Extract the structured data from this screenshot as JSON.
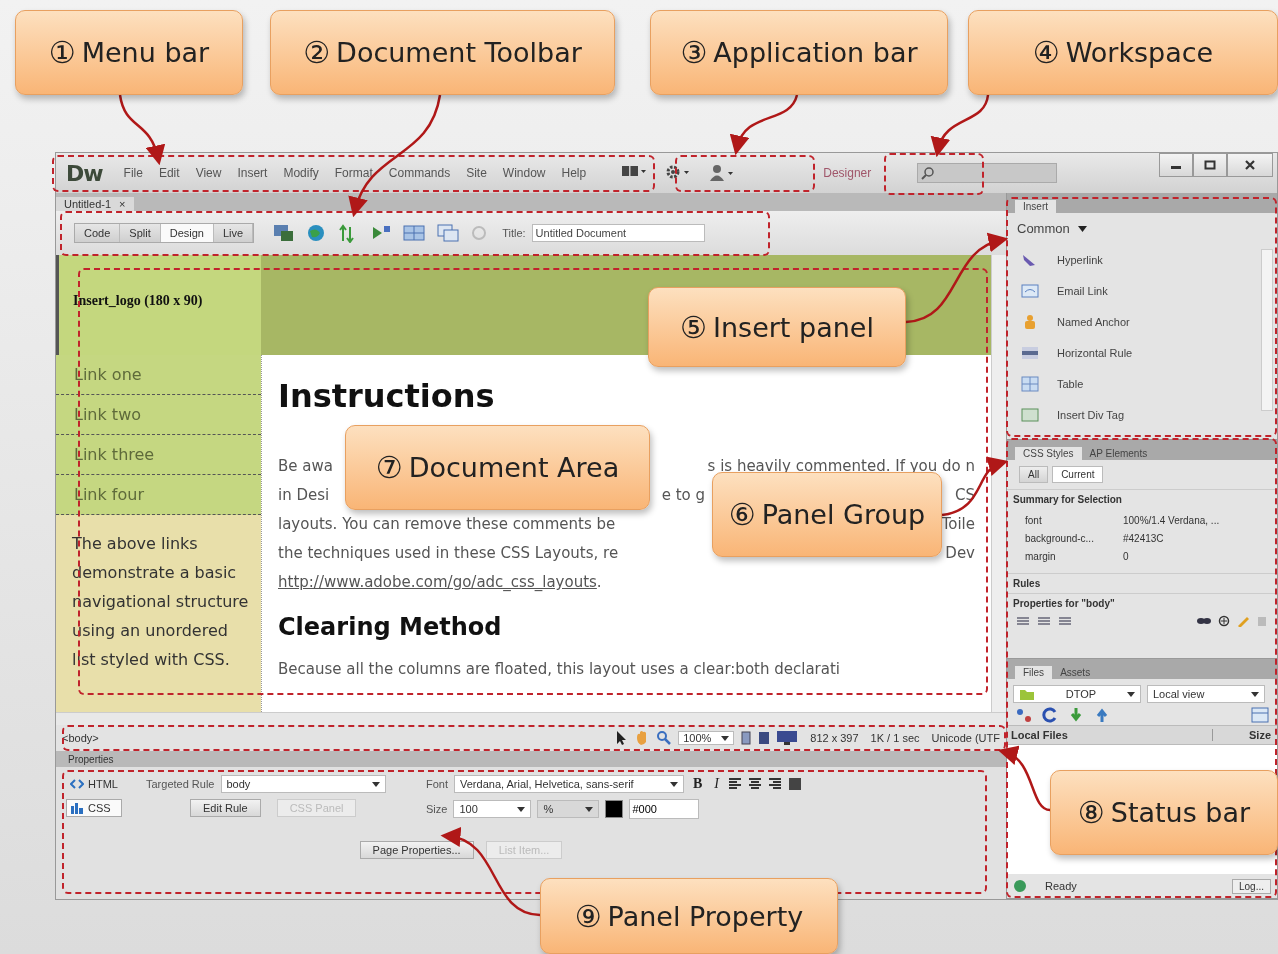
{
  "callouts": [
    {
      "number": "①",
      "label": "Menu bar"
    },
    {
      "number": "②",
      "label": "Document Toolbar"
    },
    {
      "number": "③",
      "label": "Application bar"
    },
    {
      "number": "④",
      "label": "Workspace"
    },
    {
      "number": "⑤",
      "label": "Insert panel"
    },
    {
      "number": "⑦",
      "label": "Document Area"
    },
    {
      "number": "⑥",
      "label": "Panel Group"
    },
    {
      "number": "⑧",
      "label": "Status bar"
    },
    {
      "number": "⑨",
      "label": "Panel Property"
    }
  ],
  "menu_bar": {
    "logo": "Dw",
    "items": [
      "File",
      "Edit",
      "View",
      "Insert",
      "Modify",
      "Format",
      "Commands",
      "Site",
      "Window",
      "Help"
    ]
  },
  "application_bar": {
    "workspace": "Designer"
  },
  "document_tab": {
    "title": "Untitled-1",
    "close": "×"
  },
  "document_toolbar": {
    "views": [
      {
        "label": "Code",
        "selected": false
      },
      {
        "label": "Split",
        "selected": false
      },
      {
        "label": "Design",
        "selected": true
      },
      {
        "label": "Live",
        "selected": false
      }
    ],
    "title_label": "Title:",
    "title_value": "Untitled Document"
  },
  "design_view": {
    "logo_placeholder": "Insert_logo (180 x 90)",
    "nav_links": [
      "Link one",
      "Link two",
      "Link three",
      "Link four"
    ],
    "sidebar_text": "The above links demonstrate a basic navigational structure using an unordered list styled with CSS.",
    "heading": "Instructions",
    "paragraph_lines": [
      [
        "Be awa",
        "s is heavily commented. If you do n"
      ],
      [
        "in Desi",
        "e to g",
        "CS"
      ],
      [
        "layouts. You can remove these comments be",
        "Toile"
      ],
      [
        "the techniques used in these CSS Layouts, re",
        "Dev"
      ]
    ],
    "link": "http://www.adobe.com/go/adc_css_layouts",
    "link_suffix": ".",
    "heading_2": "Clearing Method",
    "last_line": "Because all the columns are floated, this layout uses a clear:both declarati"
  },
  "status_bar": {
    "tag": "<body>",
    "zoom": "100%",
    "window_size": "812 x 397",
    "download": "1K / 1 sec",
    "encoding": "Unicode (UTF"
  },
  "properties": {
    "title": "Properties",
    "modes": [
      {
        "label": "HTML",
        "selected": false
      },
      {
        "label": "CSS",
        "selected": true
      }
    ],
    "targeted_rule_label": "Targeted Rule",
    "targeted_rule": "body",
    "buttons": [
      {
        "label": "Edit Rule",
        "disabled": false
      },
      {
        "label": "CSS Panel",
        "disabled": true
      }
    ],
    "font_label": "Font",
    "font": "Verdana, Arial, Helvetica, sans-serif",
    "format_buttons": [
      "B",
      "I"
    ],
    "size_label": "Size",
    "size": "100",
    "unit": "%",
    "text_color": "#000",
    "bottom_buttons": [
      {
        "label": "Page Properties...",
        "disabled": false
      },
      {
        "label": "List Item...",
        "disabled": true
      }
    ]
  },
  "insert_panel": {
    "tab": "Insert",
    "category": "Common",
    "items": [
      "Hyperlink",
      "Email Link",
      "Named Anchor",
      "Horizontal Rule",
      "Table",
      "Insert Div Tag"
    ]
  },
  "css_panel": {
    "tabs": [
      {
        "label": "CSS Styles",
        "selected": true
      },
      {
        "label": "AP Elements",
        "selected": false
      }
    ],
    "modes": [
      {
        "label": "All",
        "selected": false
      },
      {
        "label": "Current",
        "selected": true
      }
    ],
    "summary_title": "Summary for Selection",
    "rows": [
      {
        "property": "font",
        "value": "100%/1.4 Verdana, ..."
      },
      {
        "property": "background-c...",
        "value": "#42413C"
      },
      {
        "property": "margin",
        "value": "0"
      }
    ],
    "rules_title": "Rules",
    "properties_title": "Properties for \"body\""
  },
  "files_panel": {
    "tabs": [
      {
        "label": "Files",
        "selected": true
      },
      {
        "label": "Assets",
        "selected": false
      }
    ],
    "site": "DTOP",
    "view": "Local view",
    "columns": [
      "Local Files",
      "Size"
    ],
    "status": "Ready",
    "log_button": "Log..."
  }
}
